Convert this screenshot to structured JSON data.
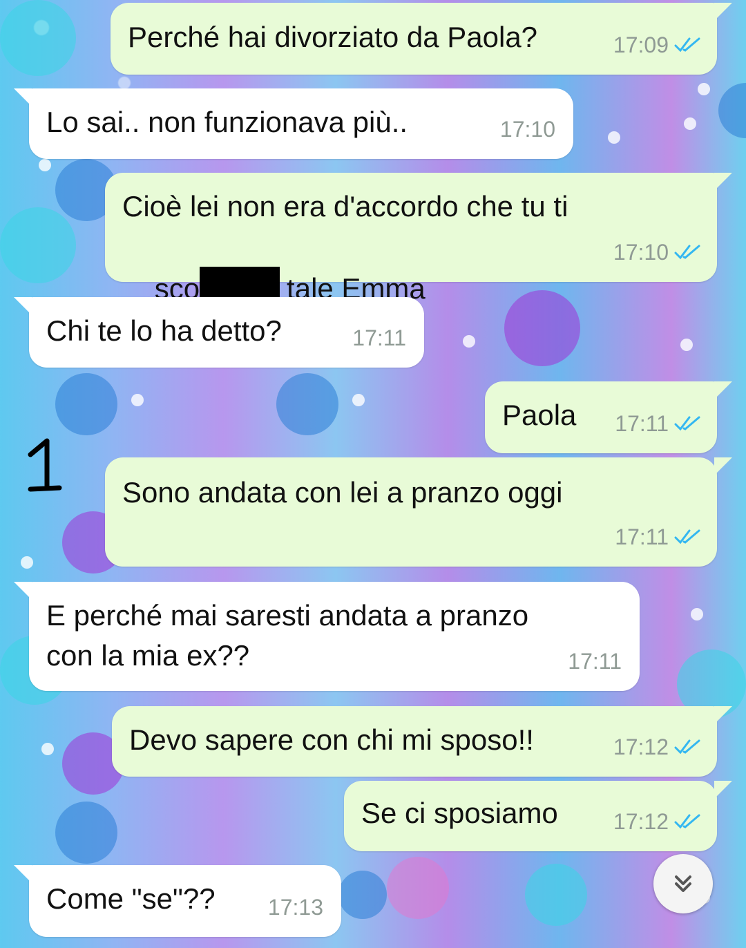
{
  "theme": {
    "outgoing_bubble": "#e8fbd7",
    "incoming_bubble": "#ffffff",
    "read_tick_color": "#34b7f1"
  },
  "annotation_label": "1",
  "messages": [
    {
      "dir": "out",
      "text": "Perché hai divorziato da Paola?",
      "time": "17:09",
      "read": true
    },
    {
      "dir": "in",
      "text": "Lo sai.. non funzionava più..",
      "time": "17:10"
    },
    {
      "dir": "out",
      "text_line1": "Cioè lei non era d'accordo che tu ti",
      "text_line2_prefix": "sco",
      "text_line2_suffix": "tale Emma",
      "redacted": true,
      "time": "17:10",
      "read": true
    },
    {
      "dir": "in",
      "text": "Chi te lo ha detto?",
      "time": "17:11"
    },
    {
      "dir": "out",
      "text": "Paola",
      "time": "17:11",
      "read": true
    },
    {
      "dir": "out",
      "text": "Sono andata con lei a pranzo oggi",
      "time": "17:11",
      "read": true
    },
    {
      "dir": "in",
      "text_line1": "E perché mai saresti andata a pranzo",
      "text_line2": "con la mia ex??",
      "time": "17:11"
    },
    {
      "dir": "out",
      "text": "Devo sapere con chi mi sposo!!",
      "time": "17:12",
      "read": true
    },
    {
      "dir": "out",
      "text": "Se ci sposiamo",
      "time": "17:12",
      "read": true
    },
    {
      "dir": "in",
      "text": "Come \"se\"??",
      "time": "17:13"
    }
  ],
  "scroll_button": {
    "icon": "double-chevron-down-icon"
  }
}
